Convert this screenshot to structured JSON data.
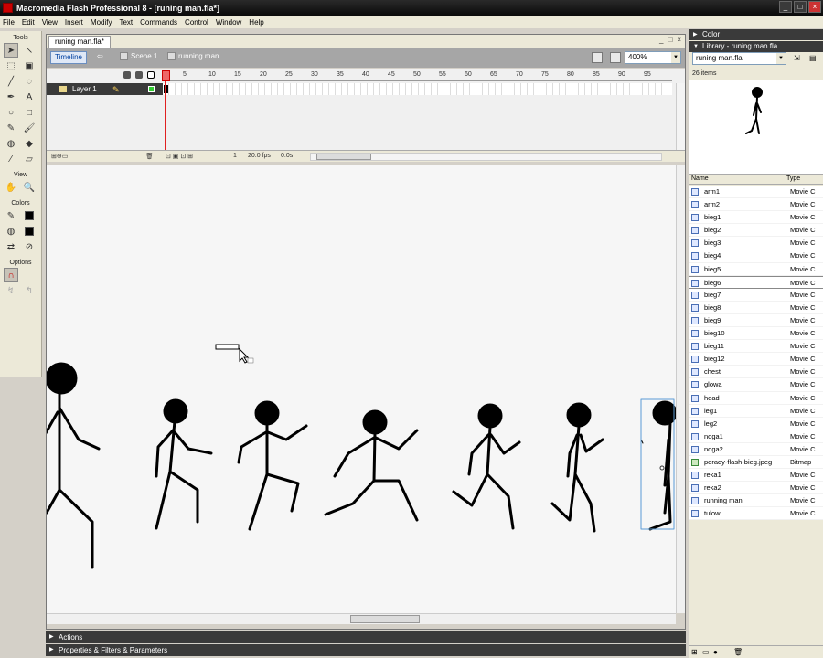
{
  "window": {
    "title": "Macromedia Flash Professional 8 - [runing man.fla*]",
    "controls": [
      "_",
      "□",
      "×"
    ]
  },
  "menu": [
    "File",
    "Edit",
    "View",
    "Insert",
    "Modify",
    "Text",
    "Commands",
    "Control",
    "Window",
    "Help"
  ],
  "tools": {
    "header": "Tools",
    "view": "View",
    "colors": "Colors",
    "options": "Options"
  },
  "document": {
    "tab": "runing man.fla*",
    "controls": [
      "_",
      "□",
      "×"
    ],
    "timeline_button": "Timeline",
    "scene": "Scene 1",
    "symbol": "running man",
    "zoom": "400%"
  },
  "timeline": {
    "ruler": [
      "1",
      "5",
      "10",
      "15",
      "20",
      "25",
      "30",
      "35",
      "40",
      "45",
      "50",
      "55",
      "60",
      "65",
      "70",
      "75",
      "80",
      "85",
      "90",
      "95"
    ],
    "layer": "Layer 1",
    "current_frame": "1",
    "fps": "20.0 fps",
    "time": "0.0s"
  },
  "panels": {
    "actions": "Actions",
    "properties": "Properties & Filters & Parameters"
  },
  "right": {
    "color": "Color",
    "library_title": "Library - runing man.fla",
    "library_select": "runing man.fla",
    "item_count": "26 items",
    "col_name": "Name",
    "col_type": "Type",
    "items": [
      {
        "name": "arm1",
        "type": "Movie C"
      },
      {
        "name": "arm2",
        "type": "Movie C"
      },
      {
        "name": "bieg1",
        "type": "Movie C"
      },
      {
        "name": "bieg2",
        "type": "Movie C"
      },
      {
        "name": "bieg3",
        "type": "Movie C"
      },
      {
        "name": "bieg4",
        "type": "Movie C"
      },
      {
        "name": "bieg5",
        "type": "Movie C"
      },
      {
        "name": "bieg6",
        "type": "Movie C"
      },
      {
        "name": "bieg7",
        "type": "Movie C"
      },
      {
        "name": "bieg8",
        "type": "Movie C"
      },
      {
        "name": "bieg9",
        "type": "Movie C"
      },
      {
        "name": "bieg10",
        "type": "Movie C"
      },
      {
        "name": "bieg11",
        "type": "Movie C"
      },
      {
        "name": "bieg12",
        "type": "Movie C"
      },
      {
        "name": "chest",
        "type": "Movie C"
      },
      {
        "name": "glowa",
        "type": "Movie C"
      },
      {
        "name": "head",
        "type": "Movie C"
      },
      {
        "name": "leg1",
        "type": "Movie C"
      },
      {
        "name": "leg2",
        "type": "Movie C"
      },
      {
        "name": "noga1",
        "type": "Movie C"
      },
      {
        "name": "noga2",
        "type": "Movie C"
      },
      {
        "name": "porady-flash-bieg.jpeg",
        "type": "Bitmap"
      },
      {
        "name": "reka1",
        "type": "Movie C"
      },
      {
        "name": "reka2",
        "type": "Movie C"
      },
      {
        "name": "running man",
        "type": "Movie C"
      },
      {
        "name": "tulow",
        "type": "Movie C"
      }
    ]
  }
}
